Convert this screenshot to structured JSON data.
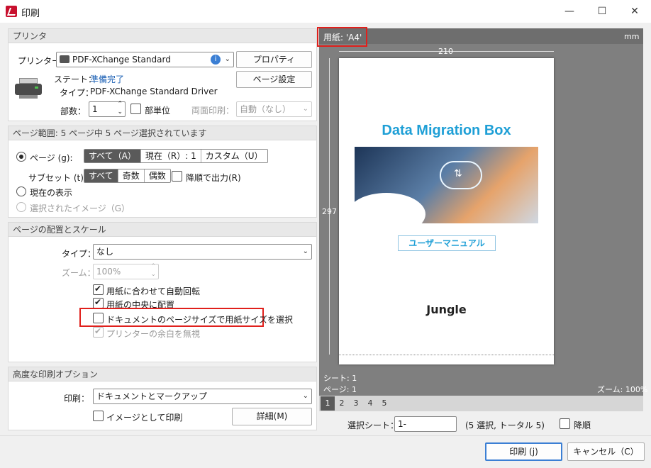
{
  "window": {
    "title": "印刷",
    "minimize": "—",
    "maximize": "☐",
    "close": "✕"
  },
  "printer_section": {
    "header": "プリンタ",
    "printer_label": "プリンター...",
    "printer_value": "PDF-XChange Standard",
    "properties_button": "プロパティ",
    "page_setup_button": "ページ設定",
    "status_label": "ステート：",
    "status_value": "準備完了",
    "type_label": "タイプ：",
    "type_value": "PDF-XChange Standard Driver",
    "copies_label": "部数：",
    "copies_value": "1",
    "collate_label": "部単位",
    "duplex_label": "両面印刷：",
    "duplex_value": "自動（なし）"
  },
  "range_section": {
    "header": "ページ範囲: 5 ページ中 5 ページ選択されています",
    "pages_label": "ページ (g):",
    "pages_options": [
      "すべて（A）",
      "現在（R）: 1",
      "カスタム（U）"
    ],
    "subset_label": "サブセット (t):",
    "subset_options": [
      "すべて",
      "奇数",
      "偶数"
    ],
    "reverse_label": "降順で出力(R)",
    "current_view_label": "現在の表示",
    "selected_image_label": "選択されたイメージ（G）"
  },
  "placement_section": {
    "header": "ページの配置とスケール",
    "type_label": "タイプ：",
    "type_value": "なし",
    "zoom_label": "ズーム：",
    "zoom_value": "100%",
    "auto_rotate_label": "用紙に合わせて自動回転",
    "center_label": "用紙の中央に配置",
    "choose_paper_label": "ドキュメントのページサイズで用紙サイズを選択",
    "ignore_margins_label": "プリンターの余白を無視"
  },
  "advanced_section": {
    "header": "高度な印刷オプション",
    "print_label": "印刷：",
    "print_value": "ドキュメントとマークアップ",
    "as_image_label": "イメージとして印刷",
    "details_button": "詳細(M)"
  },
  "preview": {
    "paper_label": "用紙: 'A4'",
    "unit": "mm",
    "width": "210",
    "height": "297",
    "sheet_label": "シート: 1",
    "page_label": "ページ: 1",
    "zoom_label": "ズーム: 100%",
    "page_tabs": [
      "1",
      "2",
      "3",
      "4",
      "5"
    ],
    "doc_title": "Data Migration Box",
    "doc_subtitle": "ユーザーマニュアル",
    "doc_brand": "Jungle"
  },
  "sheet_select": {
    "label": "選択シート：",
    "value": "1-",
    "info": "(5 選択, トータル 5)",
    "reverse_label": "降順"
  },
  "footer": {
    "print_button": "印刷 (j)",
    "cancel_button": "キャンセル（C）"
  },
  "colors": {
    "accent_title": "#1e9fd6",
    "highlight": "#e0201c",
    "preview_bg": "#7f7f7f"
  }
}
